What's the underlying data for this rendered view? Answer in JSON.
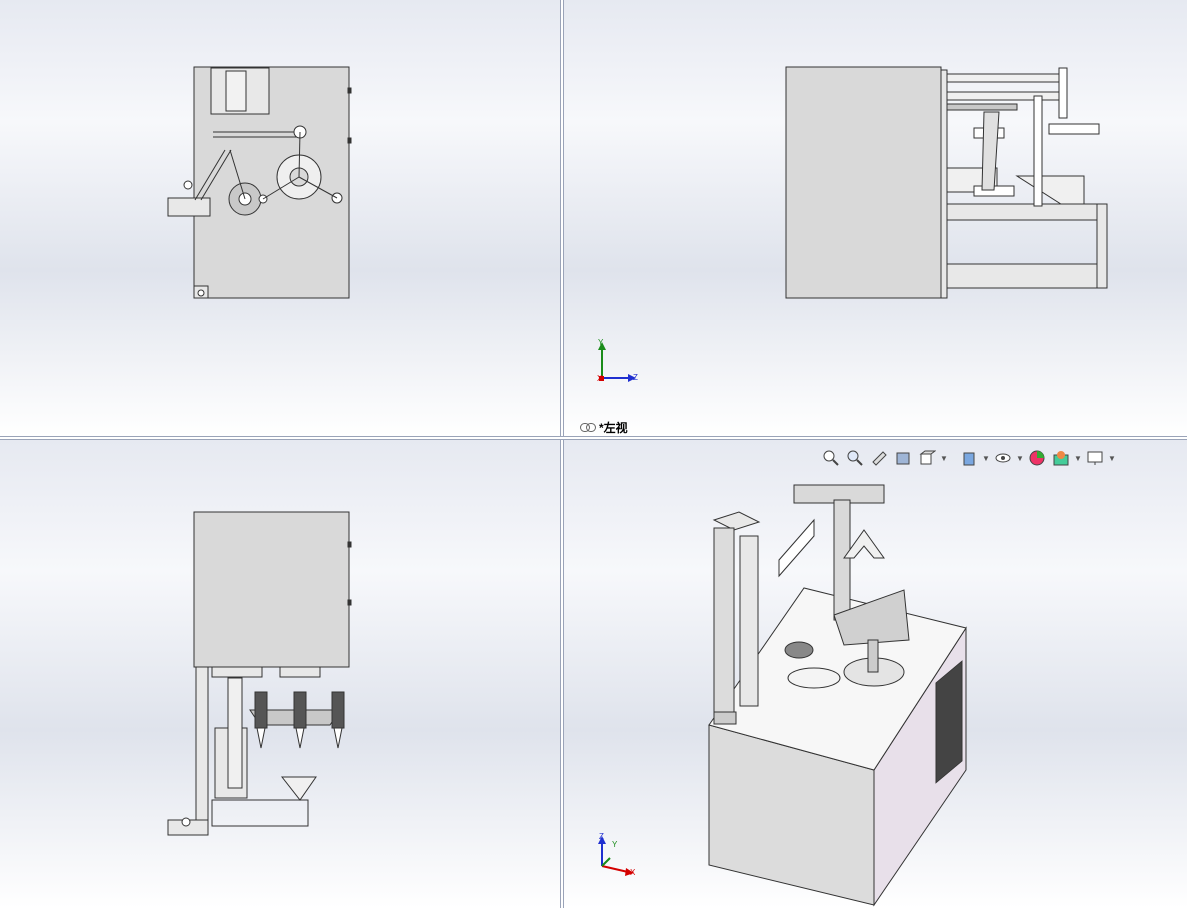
{
  "viewports": {
    "front_top_left": {
      "name": "front view"
    },
    "left_top_right": {
      "name": "left view",
      "label": "*左视"
    },
    "top_bottom_left": {
      "name": "top view"
    },
    "iso_bottom_right": {
      "name": "isometric view"
    }
  },
  "triads": {
    "left_view": {
      "axis_1": "Y",
      "axis_2": "Z",
      "axis_3": "X"
    },
    "iso_view": {
      "axis_1": "Z",
      "axis_2": "Y",
      "axis_3": "X"
    }
  },
  "heads_up_toolbar": {
    "tools": [
      "zoom-to-fit-icon",
      "zoom-to-area-icon",
      "previous-view-icon",
      "section-view-icon",
      "view-orientation-icon",
      "display-style-icon",
      "hide-show-icon",
      "edit-appearance-icon",
      "apply-scene-icon",
      "view-settings-icon"
    ]
  },
  "colors": {
    "background_top": "#e6e9f1",
    "background_bottom": "#ffffff",
    "part_fill": "#d9d9d9",
    "line": "#333333",
    "axis_x": "#d40000",
    "axis_y": "#1a8c1a",
    "axis_z": "#1f2fd0"
  }
}
